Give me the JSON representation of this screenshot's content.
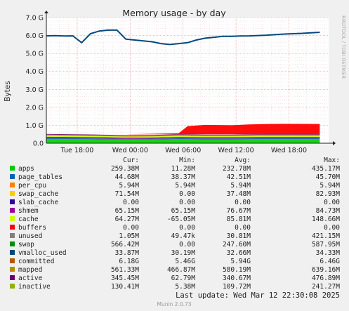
{
  "chart_data": {
    "type": "area",
    "title": "Memory usage - by day",
    "ylabel": "Bytes",
    "side_label": "RRDTOOL / TOBI OETIKER",
    "ylim": [
      0,
      7.0
    ],
    "y_unit": "G",
    "y_ticks": [
      "0.0",
      "1.0 G",
      "2.0 G",
      "3.0 G",
      "4.0 G",
      "5.0 G",
      "6.0 G",
      "7.0 G"
    ],
    "x_tick_labels": [
      "Tue 18:00",
      "Wed 00:00",
      "Wed 06:00",
      "Wed 12:00",
      "Wed 18:00"
    ],
    "x_ticks_hours_from_start": [
      3.5,
      9.5,
      15.5,
      21.5,
      27.5
    ],
    "x_range_hours": 32,
    "committed_approx": [
      [
        0,
        5.98
      ],
      [
        1,
        5.99
      ],
      [
        2,
        5.97
      ],
      [
        3,
        5.98
      ],
      [
        4,
        5.6
      ],
      [
        5,
        6.1
      ],
      [
        6,
        6.25
      ],
      [
        7,
        6.3
      ],
      [
        8,
        6.3
      ],
      [
        9,
        5.8
      ],
      [
        10,
        5.75
      ],
      [
        11,
        5.7
      ],
      [
        12,
        5.65
      ],
      [
        13,
        5.55
      ],
      [
        14,
        5.5
      ],
      [
        15,
        5.55
      ],
      [
        16,
        5.6
      ],
      [
        17,
        5.75
      ],
      [
        18,
        5.85
      ],
      [
        19,
        5.9
      ],
      [
        20,
        5.95
      ],
      [
        21,
        5.95
      ],
      [
        22,
        5.97
      ],
      [
        23,
        5.98
      ],
      [
        24,
        6.0
      ],
      [
        25,
        6.02
      ],
      [
        26,
        6.05
      ],
      [
        27,
        6.08
      ],
      [
        28,
        6.1
      ],
      [
        29,
        6.12
      ],
      [
        30,
        6.15
      ],
      [
        31,
        6.18
      ]
    ],
    "swap_approx": [
      [
        0,
        0.0
      ],
      [
        9,
        0.0
      ],
      [
        15,
        0.05
      ],
      [
        16,
        0.45
      ],
      [
        18,
        0.52
      ],
      [
        21,
        0.5
      ],
      [
        23,
        0.55
      ],
      [
        25,
        0.57
      ],
      [
        27,
        0.58
      ],
      [
        31,
        0.57
      ]
    ],
    "stack_approx": [
      [
        0,
        0.52
      ],
      [
        3,
        0.5
      ],
      [
        6,
        0.48
      ],
      [
        9,
        0.45
      ],
      [
        12,
        0.46
      ],
      [
        15,
        0.5
      ],
      [
        18,
        0.48
      ],
      [
        21,
        0.48
      ],
      [
        24,
        0.5
      ],
      [
        27,
        0.5
      ],
      [
        31,
        0.5
      ]
    ],
    "columns": [
      "Cur:",
      "Min:",
      "Avg:",
      "Max:"
    ],
    "series": [
      {
        "name": "apps",
        "color": "#00cc00",
        "cur": "259.38M",
        "min": "11.28M",
        "avg": "232.78M",
        "max": "435.17M"
      },
      {
        "name": "page_tables",
        "color": "#0066b3",
        "cur": "44.68M",
        "min": "38.37M",
        "avg": "42.51M",
        "max": "45.70M"
      },
      {
        "name": "per_cpu",
        "color": "#ff8000",
        "cur": "5.94M",
        "min": "5.94M",
        "avg": "5.94M",
        "max": "5.94M"
      },
      {
        "name": "swap_cache",
        "color": "#ffcc00",
        "cur": "71.54M",
        "min": "0.00",
        "avg": "37.48M",
        "max": "82.93M"
      },
      {
        "name": "slab_cache",
        "color": "#330099",
        "cur": "0.00",
        "min": "0.00",
        "avg": "0.00",
        "max": "0.00"
      },
      {
        "name": "shmem",
        "color": "#990099",
        "cur": "65.15M",
        "min": "65.15M",
        "avg": "76.67M",
        "max": "84.73M"
      },
      {
        "name": "cache",
        "color": "#ccff00",
        "cur": "64.27M",
        "min": "-65.05M",
        "avg": "85.81M",
        "max": "148.66M"
      },
      {
        "name": "buffers",
        "color": "#ff0000",
        "cur": "0.00",
        "min": "0.00",
        "avg": "0.00",
        "max": "0.00"
      },
      {
        "name": "unused",
        "color": "#808080",
        "cur": "1.05M",
        "min": "49.47k",
        "avg": "30.81M",
        "max": "421.15M"
      },
      {
        "name": "swap",
        "color": "#008f00",
        "cur": "566.42M",
        "min": "0.00",
        "avg": "247.60M",
        "max": "587.95M"
      },
      {
        "name": "vmalloc_used",
        "color": "#00487d",
        "cur": "33.87M",
        "min": "30.19M",
        "avg": "32.66M",
        "max": "34.33M"
      },
      {
        "name": "committed",
        "color": "#b35a00",
        "cur": "6.18G",
        "min": "5.46G",
        "avg": "5.94G",
        "max": "6.46G"
      },
      {
        "name": "mapped",
        "color": "#b38f00",
        "cur": "561.33M",
        "min": "466.87M",
        "avg": "580.19M",
        "max": "639.16M"
      },
      {
        "name": "active",
        "color": "#6b006b",
        "cur": "345.45M",
        "min": "62.79M",
        "avg": "340.67M",
        "max": "476.89M"
      },
      {
        "name": "inactive",
        "color": "#8fb300",
        "cur": "130.41M",
        "min": "5.38M",
        "avg": "109.72M",
        "max": "241.27M"
      }
    ]
  },
  "footer": {
    "last_update": "Last update: Wed Mar 12 22:30:08 2025",
    "version": "Munin 2.0.73"
  }
}
